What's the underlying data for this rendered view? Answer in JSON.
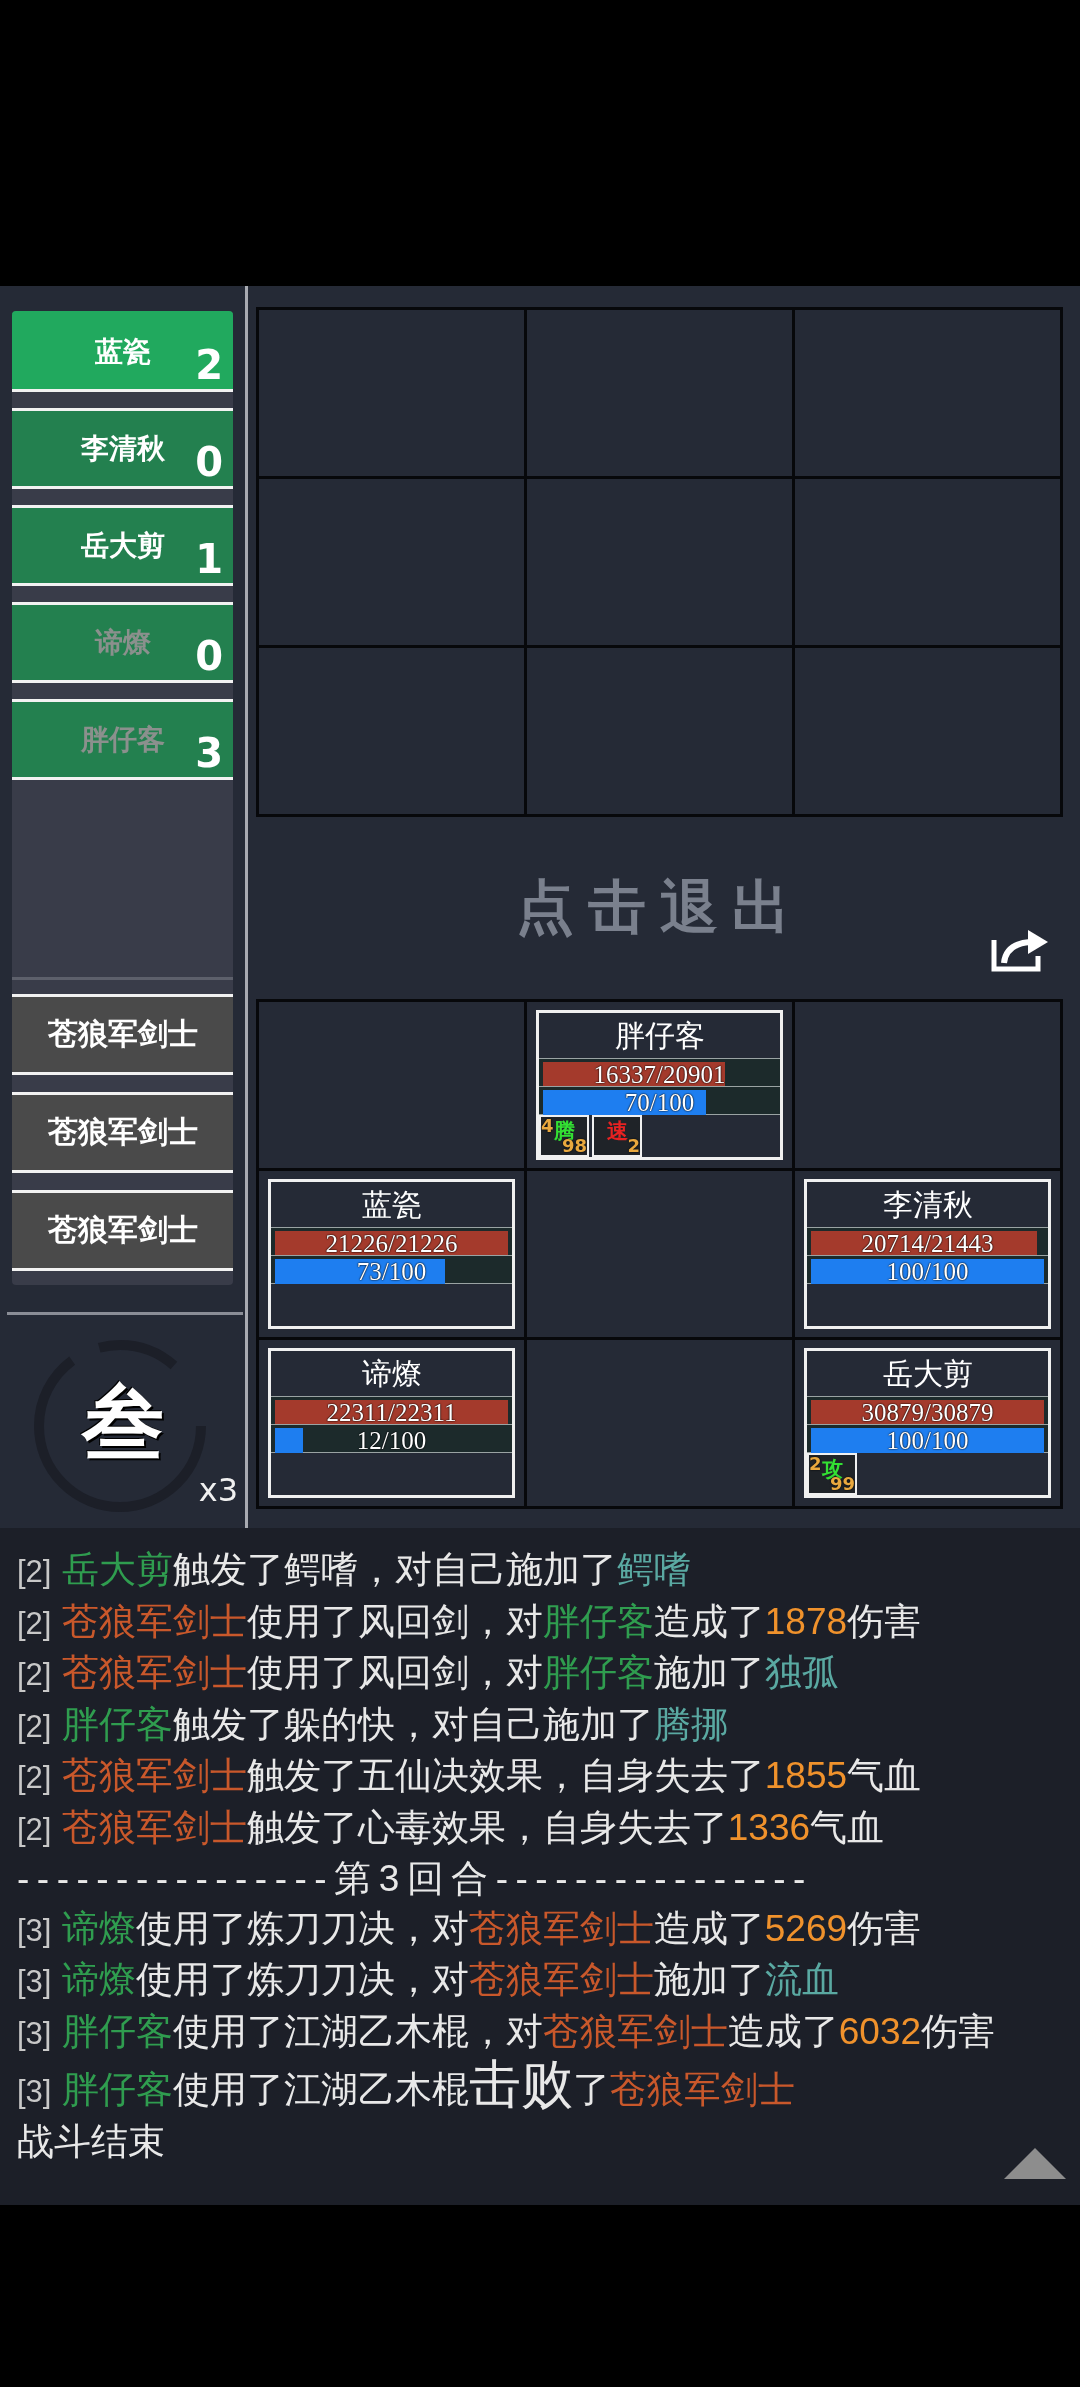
{
  "players": [
    {
      "name": "蓝瓷",
      "count": "2",
      "selected": true,
      "disabled": false
    },
    {
      "name": "李清秋",
      "count": "0",
      "selected": false,
      "disabled": false
    },
    {
      "name": "岳大剪",
      "count": "1",
      "selected": false,
      "disabled": false
    },
    {
      "name": "谛燎",
      "count": "0",
      "selected": false,
      "disabled": true
    },
    {
      "name": "胖仔客",
      "count": "3",
      "selected": false,
      "disabled": true
    }
  ],
  "enemies": [
    {
      "name": "苍狼军剑士"
    },
    {
      "name": "苍狼军剑士"
    },
    {
      "name": "苍狼军剑士"
    }
  ],
  "round": {
    "numeral": "叁",
    "multiplier": "x3"
  },
  "enemy_grid": [
    {
      "occupied": false
    },
    {
      "occupied": false
    },
    {
      "occupied": false
    },
    {
      "occupied": false
    },
    {
      "occupied": false
    },
    {
      "occupied": false
    },
    {
      "occupied": false
    },
    {
      "occupied": false
    },
    {
      "occupied": false
    }
  ],
  "exit_prompt": "点击退出",
  "ally_grid": [
    {
      "occupied": false
    },
    {
      "occupied": true,
      "name": "胖仔客",
      "hp": {
        "text": "16337/20901",
        "level": 0.78
      },
      "mp": {
        "text": "70/100",
        "level": 0.7
      },
      "buffs": [
        {
          "glyph": "腾",
          "color": "#33e033",
          "stacks": "4",
          "turns": "98"
        },
        {
          "glyph": "速",
          "color": "#e82222",
          "turns": "2"
        }
      ]
    },
    {
      "occupied": false
    },
    {
      "occupied": true,
      "name": "蓝瓷",
      "hp": {
        "text": "21226/21226",
        "level": 1
      },
      "mp": {
        "text": "73/100",
        "level": 0.73
      }
    },
    {
      "occupied": false
    },
    {
      "occupied": true,
      "name": "李清秋",
      "hp": {
        "text": "20714/21443",
        "level": 0.97
      },
      "mp": {
        "text": "100/100",
        "level": 1
      }
    },
    {
      "occupied": true,
      "name": "谛燎",
      "hp": {
        "text": "22311/22311",
        "level": 1
      },
      "mp": {
        "text": "12/100",
        "level": 0.12
      }
    },
    {
      "occupied": false
    },
    {
      "occupied": true,
      "name": "岳大剪",
      "hp": {
        "text": "30879/30879",
        "level": 1
      },
      "mp": {
        "text": "100/100",
        "level": 1
      },
      "buffs": [
        {
          "glyph": "攻",
          "color": "#33e033",
          "stacks": "2",
          "turns": "99"
        }
      ]
    }
  ],
  "log": [
    {
      "kind": "message",
      "round": "[2]",
      "parts": [
        {
          "kind": "ally",
          "text": "岳大剪"
        },
        {
          "kind": "plain",
          "text": "触发了鳄嗜，对自己施加了"
        },
        {
          "kind": "effect",
          "text": "鳄嗜"
        }
      ]
    },
    {
      "kind": "message",
      "round": "[2]",
      "parts": [
        {
          "kind": "enemy",
          "text": "苍狼军剑士"
        },
        {
          "kind": "plain",
          "text": "使用了风回剑，对"
        },
        {
          "kind": "ally",
          "text": "胖仔客"
        },
        {
          "kind": "plain",
          "text": "造成了"
        },
        {
          "kind": "number",
          "text": "1878"
        },
        {
          "kind": "plain",
          "text": "伤害"
        }
      ]
    },
    {
      "kind": "message",
      "round": "[2]",
      "parts": [
        {
          "kind": "enemy",
          "text": "苍狼军剑士"
        },
        {
          "kind": "plain",
          "text": "使用了风回剑，对"
        },
        {
          "kind": "ally",
          "text": "胖仔客"
        },
        {
          "kind": "plain",
          "text": "施加了"
        },
        {
          "kind": "effect",
          "text": "独孤"
        }
      ]
    },
    {
      "kind": "message",
      "round": "[2]",
      "parts": [
        {
          "kind": "ally",
          "text": "胖仔客"
        },
        {
          "kind": "plain",
          "text": "触发了躲的快，对自己施加了"
        },
        {
          "kind": "effect",
          "text": "腾挪"
        }
      ]
    },
    {
      "kind": "message",
      "round": "[2]",
      "parts": [
        {
          "kind": "enemy",
          "text": "苍狼军剑士"
        },
        {
          "kind": "plain",
          "text": "触发了五仙决效果，自身失去了"
        },
        {
          "kind": "number",
          "text": "1855"
        },
        {
          "kind": "plain",
          "text": "气血"
        }
      ]
    },
    {
      "kind": "message",
      "round": "[2]",
      "parts": [
        {
          "kind": "enemy",
          "text": "苍狼军剑士"
        },
        {
          "kind": "plain",
          "text": "触发了心毒效果，自身失去了"
        },
        {
          "kind": "number",
          "text": "1336"
        },
        {
          "kind": "plain",
          "text": "气血"
        }
      ]
    },
    {
      "kind": "divider",
      "text": "----------------第3回合----------------"
    },
    {
      "kind": "message",
      "round": "[3]",
      "parts": [
        {
          "kind": "ally",
          "text": "谛燎"
        },
        {
          "kind": "plain",
          "text": "使用了炼刀刀决，对"
        },
        {
          "kind": "enemy",
          "text": "苍狼军剑士"
        },
        {
          "kind": "plain",
          "text": "造成了"
        },
        {
          "kind": "number",
          "text": "5269"
        },
        {
          "kind": "plain",
          "text": "伤害"
        }
      ]
    },
    {
      "kind": "message",
      "round": "[3]",
      "parts": [
        {
          "kind": "ally",
          "text": "谛燎"
        },
        {
          "kind": "plain",
          "text": "使用了炼刀刀决，对"
        },
        {
          "kind": "enemy",
          "text": "苍狼军剑士"
        },
        {
          "kind": "plain",
          "text": "施加了"
        },
        {
          "kind": "effect",
          "text": "流血"
        }
      ]
    },
    {
      "kind": "message",
      "round": "[3]",
      "parts": [
        {
          "kind": "ally",
          "text": "胖仔客"
        },
        {
          "kind": "plain",
          "text": "使用了江湖乙木棍，对"
        },
        {
          "kind": "enemy",
          "text": "苍狼军剑士"
        },
        {
          "kind": "plain",
          "text": "造成了"
        },
        {
          "kind": "number",
          "text": "6032"
        },
        {
          "kind": "plain",
          "text": "伤害"
        }
      ]
    },
    {
      "kind": "message",
      "round": "[3]",
      "parts": [
        {
          "kind": "ally",
          "text": "胖仔客"
        },
        {
          "kind": "plain",
          "text": "使用了江湖乙木棍"
        },
        {
          "kind": "emphasis",
          "text": "击败"
        },
        {
          "kind": "plain",
          "text": "了"
        },
        {
          "kind": "enemy",
          "text": "苍狼军剑士"
        }
      ]
    },
    {
      "kind": "message",
      "parts": [
        {
          "kind": "plain",
          "text": "战斗结束"
        }
      ]
    }
  ]
}
